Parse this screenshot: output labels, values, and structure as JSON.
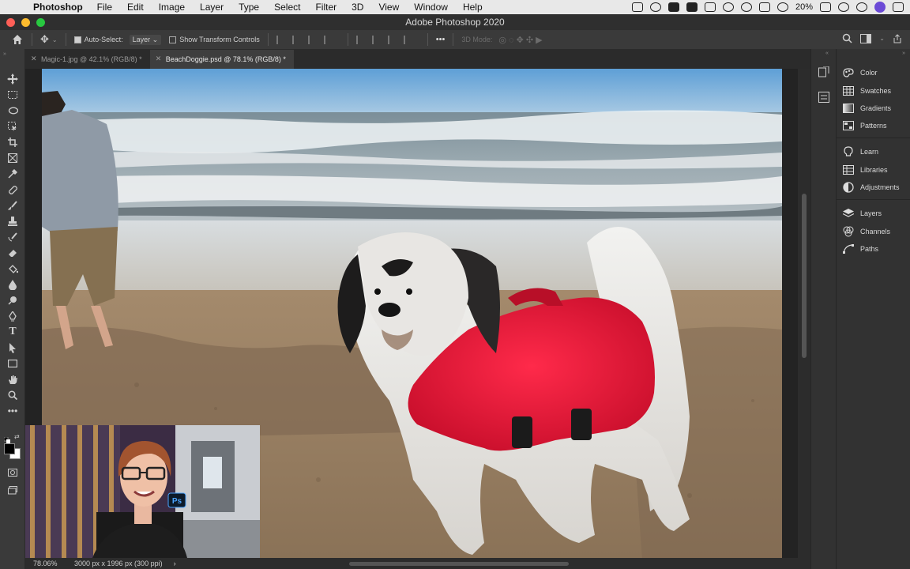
{
  "menubar": {
    "menus": [
      "Photoshop",
      "File",
      "Edit",
      "Image",
      "Layer",
      "Type",
      "Select",
      "Filter",
      "3D",
      "View",
      "Window",
      "Help"
    ],
    "battery": "20%"
  },
  "window": {
    "title": "Adobe Photoshop 2020"
  },
  "options": {
    "auto_select_label": "Auto-Select:",
    "auto_select_value": "Layer",
    "transform_label": "Show Transform Controls",
    "mode_label": "3D Mode:",
    "more_label": "•••"
  },
  "tabs": [
    {
      "label": "Magic-1.jpg @ 42.1% (RGB/8) *",
      "active": false
    },
    {
      "label": "BeachDoggie.psd @ 78.1% (RGB/8) *",
      "active": true
    }
  ],
  "status": {
    "zoom": "78.06%",
    "dims": "3000 px x 1996 px (300 ppi)",
    "chevron": "›"
  },
  "tools": [
    "move",
    "marquee",
    "lasso",
    "object-select",
    "crop",
    "frame",
    "eyedropper",
    "healing",
    "brush",
    "stamp",
    "history-brush",
    "eraser",
    "bucket",
    "blur",
    "dodge",
    "pen",
    "type",
    "path-select",
    "rectangle",
    "hand",
    "zoom",
    "more"
  ],
  "panels": [
    {
      "label": "Color",
      "icon": "color-icon"
    },
    {
      "label": "Swatches",
      "icon": "swatches-icon"
    },
    {
      "label": "Gradients",
      "icon": "gradients-icon"
    },
    {
      "label": "Patterns",
      "icon": "patterns-icon"
    },
    {
      "label": "Learn",
      "icon": "learn-icon"
    },
    {
      "label": "Libraries",
      "icon": "libraries-icon"
    },
    {
      "label": "Adjustments",
      "icon": "adjustments-icon"
    },
    {
      "label": "Layers",
      "icon": "layers-icon"
    },
    {
      "label": "Channels",
      "icon": "channels-icon"
    },
    {
      "label": "Paths",
      "icon": "paths-icon"
    }
  ],
  "webcam": {
    "badge": "Ps"
  },
  "colors": {
    "accent": "#e0001b",
    "canvas_bg": "#232323",
    "panel_bg": "#323232"
  }
}
